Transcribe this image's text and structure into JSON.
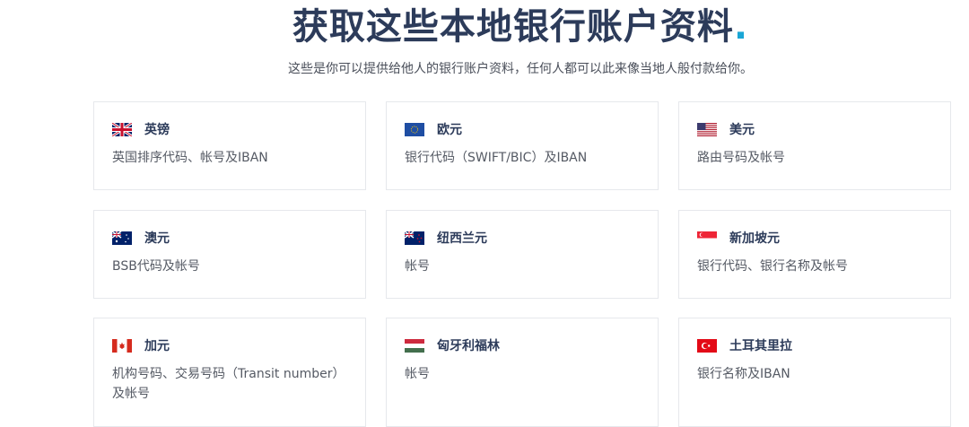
{
  "header": {
    "title": "获取这些本地银行账户资料",
    "title_dot": ".",
    "subtitle": "这些是你可以提供给他人的银行账户资料，任何人都可以此来像当地人般付款给你。"
  },
  "cards": [
    {
      "name": "英镑",
      "desc": "英国排序代码、帐号及IBAN",
      "flag": "uk-flag-icon"
    },
    {
      "name": "欧元",
      "desc": "银行代码（SWIFT/BIC）及IBAN",
      "flag": "eu-flag-icon"
    },
    {
      "name": "美元",
      "desc": "路由号码及帐号",
      "flag": "us-flag-icon"
    },
    {
      "name": "澳元",
      "desc": "BSB代码及帐号",
      "flag": "au-flag-icon"
    },
    {
      "name": "纽西兰元",
      "desc": "帐号",
      "flag": "nz-flag-icon"
    },
    {
      "name": "新加坡元",
      "desc": "银行代码、银行名称及帐号",
      "flag": "sg-flag-icon"
    },
    {
      "name": "加元",
      "desc": "机构号码、交易号码（Transit number）及帐号",
      "flag": "ca-flag-icon"
    },
    {
      "name": "匈牙利福林",
      "desc": "帐号",
      "flag": "hu-flag-icon"
    },
    {
      "name": "土耳其里拉",
      "desc": "银行名称及IBAN",
      "flag": "tr-flag-icon"
    }
  ],
  "colors": {
    "title": "#2c3b5a",
    "accent_dot": "#1aa6d6",
    "border": "#e6e8ec"
  }
}
